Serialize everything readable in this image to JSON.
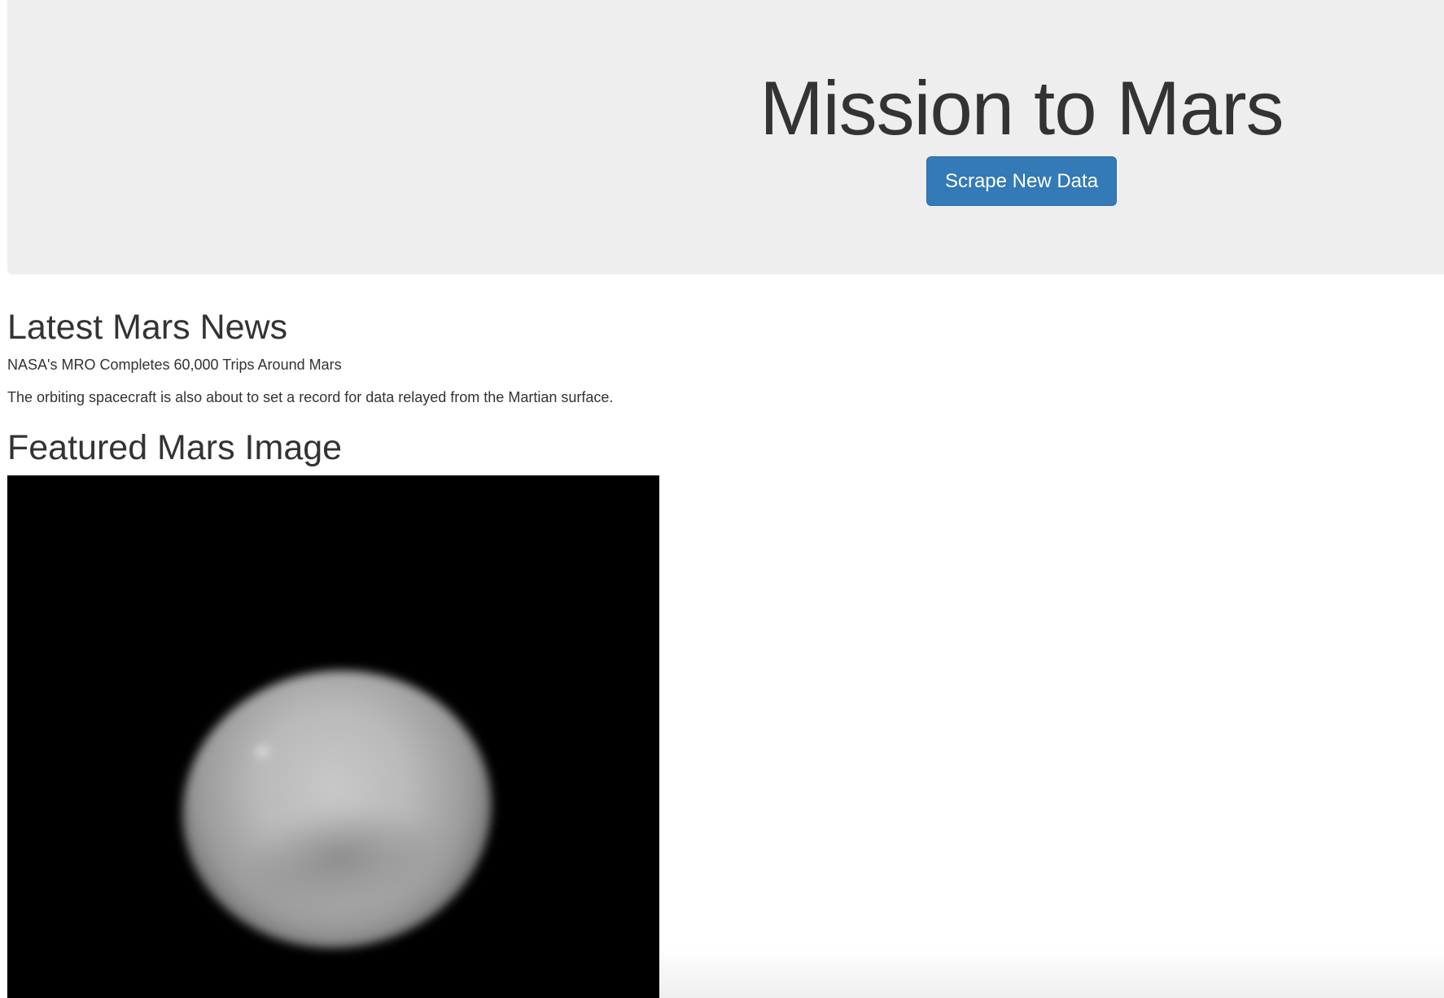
{
  "header": {
    "title": "Mission to Mars",
    "scrape_button_label": "Scrape New Data"
  },
  "news": {
    "heading": "Latest Mars News",
    "title": "NASA's MRO Completes 60,000 Trips Around Mars",
    "teaser": "The orbiting spacecraft is also about to set a record for data relayed from the Martian surface."
  },
  "featured_image": {
    "heading": "Featured Mars Image"
  },
  "colors": {
    "jumbotron_bg": "#eeeeee",
    "button_bg": "#337ab7",
    "button_border": "#2e6da4",
    "text": "#333333"
  }
}
